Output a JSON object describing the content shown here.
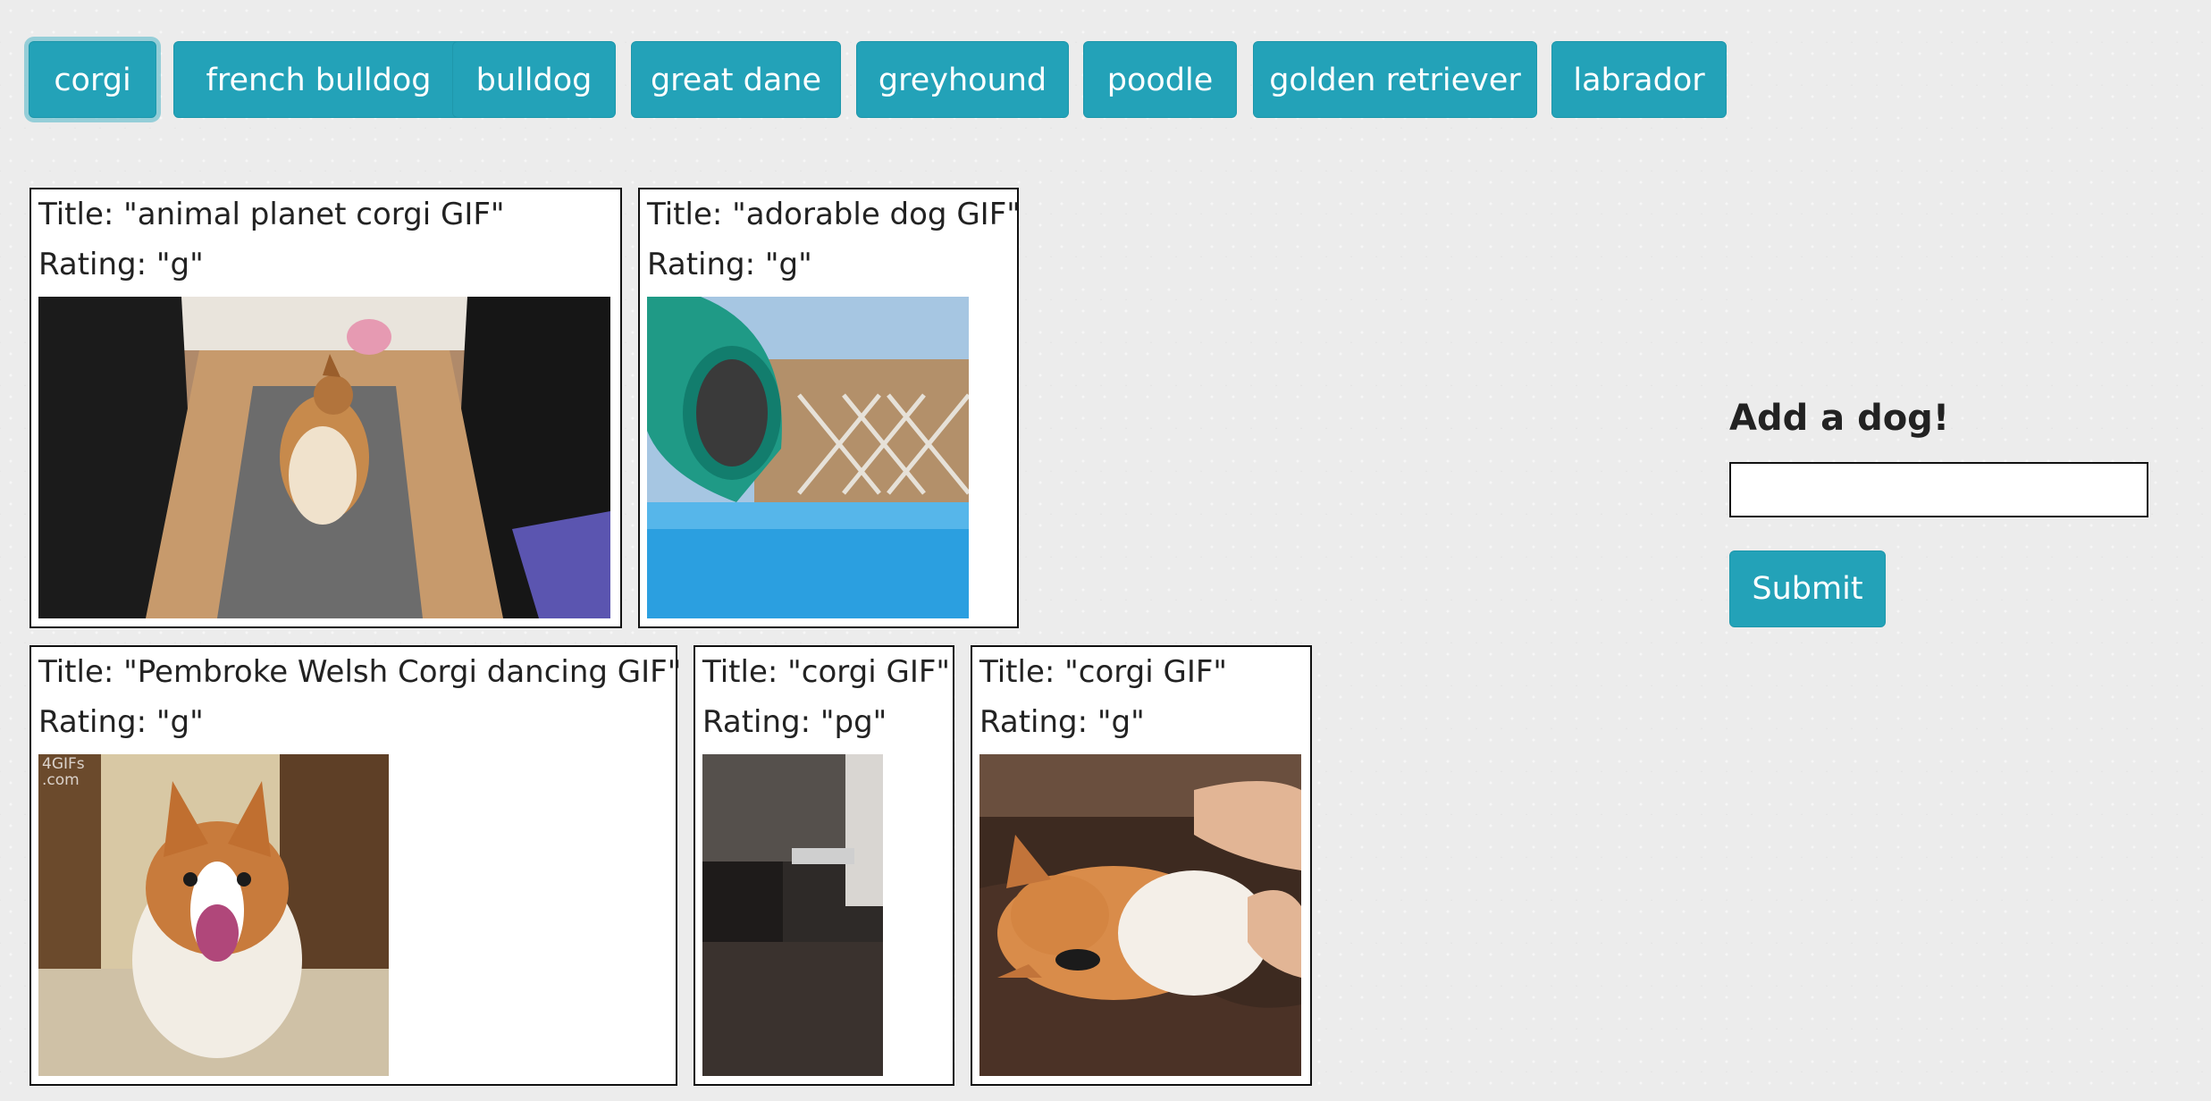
{
  "buttons": [
    {
      "label": "corgi",
      "active": true
    },
    {
      "label": "french bulldog"
    },
    {
      "label": "bulldog"
    },
    {
      "label": "great dane"
    },
    {
      "label": "greyhound"
    },
    {
      "label": "poodle"
    },
    {
      "label": "golden retriever"
    },
    {
      "label": "labrador"
    }
  ],
  "gifs": [
    {
      "title": "Title: \"animal planet corgi GIF\"",
      "rating": "Rating: \"g\""
    },
    {
      "title": "Title: \"adorable dog GIF\"",
      "rating": "Rating: \"g\""
    },
    {
      "title": "Title: \"Pembroke Welsh Corgi dancing GIF\"",
      "rating": "Rating: \"g\"",
      "watermark": "4GIFs\n.com"
    },
    {
      "title": "Title: \"corgi GIF\"",
      "rating": "Rating: \"pg\""
    },
    {
      "title": "Title: \"corgi GIF\"",
      "rating": "Rating: \"g\""
    }
  ],
  "form": {
    "heading": "Add a dog!",
    "input_value": "",
    "input_placeholder": "",
    "submit_label": "Submit"
  },
  "colors": {
    "button_bg": "#23a2b8",
    "button_text": "#ffffff",
    "page_bg": "#ececec"
  }
}
